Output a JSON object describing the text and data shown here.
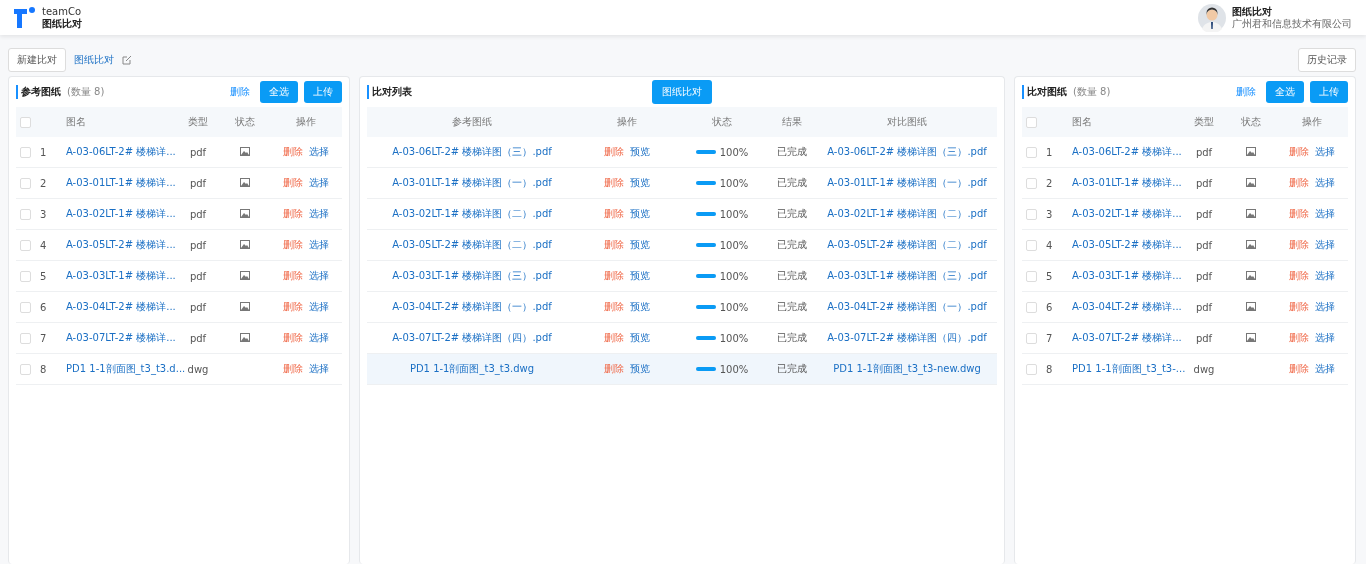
{
  "header": {
    "brand": "teamCo",
    "app": "图纸比对",
    "user_title": "图纸比对",
    "company": "广州君和信息技术有限公司"
  },
  "toolbar": {
    "new_button": "新建比对",
    "title": "图纸比对",
    "history_button": "历史记录"
  },
  "left_panel": {
    "header_checked": false,
    "title": "参考图纸",
    "count": "(数量 8)",
    "delete": "删除",
    "select_all": "全选",
    "upload": "上传",
    "columns": [
      "图名",
      "类型",
      "状态",
      "操作"
    ],
    "rows": [
      {
        "checked": false,
        "index": "1",
        "name": "A-03-06LT-2# 楼梯详...",
        "type": "pdf",
        "has_status": true,
        "delete": "删除",
        "choose": "选择"
      },
      {
        "checked": false,
        "index": "2",
        "name": "A-03-01LT-1# 楼梯详...",
        "type": "pdf",
        "has_status": true,
        "delete": "删除",
        "choose": "选择"
      },
      {
        "checked": false,
        "index": "3",
        "name": "A-03-02LT-1# 楼梯详...",
        "type": "pdf",
        "has_status": true,
        "delete": "删除",
        "choose": "选择"
      },
      {
        "checked": false,
        "index": "4",
        "name": "A-03-05LT-2# 楼梯详...",
        "type": "pdf",
        "has_status": true,
        "delete": "删除",
        "choose": "选择"
      },
      {
        "checked": false,
        "index": "5",
        "name": "A-03-03LT-1# 楼梯详...",
        "type": "pdf",
        "has_status": true,
        "delete": "删除",
        "choose": "选择"
      },
      {
        "checked": false,
        "index": "6",
        "name": "A-03-04LT-2# 楼梯详...",
        "type": "pdf",
        "has_status": true,
        "delete": "删除",
        "choose": "选择"
      },
      {
        "checked": false,
        "index": "7",
        "name": "A-03-07LT-2# 楼梯详...",
        "type": "pdf",
        "has_status": true,
        "delete": "删除",
        "choose": "选择"
      },
      {
        "checked": false,
        "index": "8",
        "name": "PD1 1-1剖面图_t3_t3.d...",
        "type": "dwg",
        "has_status": false,
        "delete": "删除",
        "choose": "选择"
      }
    ]
  },
  "compare_panel": {
    "title": "比对列表",
    "compare_button": "图纸比对",
    "columns": [
      "参考图纸",
      "操作",
      "状态",
      "结果",
      "对比图纸"
    ],
    "rows": [
      {
        "reference": "A-03-06LT-2# 楼梯详图（三）.pdf",
        "delete": "删除",
        "preview": "预览",
        "level": 1,
        "reading": "100%",
        "result": "已完成",
        "target": "A-03-06LT-2# 楼梯详图（三）.pdf",
        "highlighted": false
      },
      {
        "reference": "A-03-01LT-1# 楼梯详图（一）.pdf",
        "delete": "删除",
        "preview": "预览",
        "level": 1,
        "reading": "100%",
        "result": "已完成",
        "target": "A-03-01LT-1# 楼梯详图（一）.pdf",
        "highlighted": false
      },
      {
        "reference": "A-03-02LT-1# 楼梯详图（二）.pdf",
        "delete": "删除",
        "preview": "预览",
        "level": 1,
        "reading": "100%",
        "result": "已完成",
        "target": "A-03-02LT-1# 楼梯详图（二）.pdf",
        "highlighted": false
      },
      {
        "reference": "A-03-05LT-2# 楼梯详图（二）.pdf",
        "delete": "删除",
        "preview": "预览",
        "level": 1,
        "reading": "100%",
        "result": "已完成",
        "target": "A-03-05LT-2# 楼梯详图（二）.pdf",
        "highlighted": false
      },
      {
        "reference": "A-03-03LT-1# 楼梯详图（三）.pdf",
        "delete": "删除",
        "preview": "预览",
        "level": 1,
        "reading": "100%",
        "result": "已完成",
        "target": "A-03-03LT-1# 楼梯详图（三）.pdf",
        "highlighted": false
      },
      {
        "reference": "A-03-04LT-2# 楼梯详图（一）.pdf",
        "delete": "删除",
        "preview": "预览",
        "level": 1,
        "reading": "100%",
        "result": "已完成",
        "target": "A-03-04LT-2# 楼梯详图（一）.pdf",
        "highlighted": false
      },
      {
        "reference": "A-03-07LT-2# 楼梯详图（四）.pdf",
        "delete": "删除",
        "preview": "预览",
        "level": 1,
        "reading": "100%",
        "result": "已完成",
        "target": "A-03-07LT-2# 楼梯详图（四）.pdf",
        "highlighted": false
      },
      {
        "reference": "PD1 1-1剖面图_t3_t3.dwg",
        "delete": "删除",
        "preview": "预览",
        "level": 1,
        "reading": "100%",
        "result": "已完成",
        "target": "PD1 1-1剖面图_t3_t3-new.dwg",
        "highlighted": true
      }
    ]
  },
  "right_panel": {
    "header_checked": false,
    "title": "比对图纸",
    "count": "(数量 8)",
    "delete": "删除",
    "select_all": "全选",
    "upload": "上传",
    "columns": [
      "图名",
      "类型",
      "状态",
      "操作"
    ],
    "rows": [
      {
        "checked": false,
        "index": "1",
        "name": "A-03-06LT-2# 楼梯详...",
        "type": "pdf",
        "has_status": true,
        "delete": "删除",
        "choose": "选择"
      },
      {
        "checked": false,
        "index": "2",
        "name": "A-03-01LT-1# 楼梯详...",
        "type": "pdf",
        "has_status": true,
        "delete": "删除",
        "choose": "选择"
      },
      {
        "checked": false,
        "index": "3",
        "name": "A-03-02LT-1# 楼梯详...",
        "type": "pdf",
        "has_status": true,
        "delete": "删除",
        "choose": "选择"
      },
      {
        "checked": false,
        "index": "4",
        "name": "A-03-05LT-2# 楼梯详...",
        "type": "pdf",
        "has_status": true,
        "delete": "删除",
        "choose": "选择"
      },
      {
        "checked": false,
        "index": "5",
        "name": "A-03-03LT-1# 楼梯详...",
        "type": "pdf",
        "has_status": true,
        "delete": "删除",
        "choose": "选择"
      },
      {
        "checked": false,
        "index": "6",
        "name": "A-03-04LT-2# 楼梯详...",
        "type": "pdf",
        "has_status": true,
        "delete": "删除",
        "choose": "选择"
      },
      {
        "checked": false,
        "index": "7",
        "name": "A-03-07LT-2# 楼梯详...",
        "type": "pdf",
        "has_status": true,
        "delete": "删除",
        "choose": "选择"
      },
      {
        "checked": false,
        "index": "8",
        "name": "PD1 1-1剖面图_t3_t3-...",
        "type": "dwg",
        "has_status": false,
        "delete": "删除",
        "choose": "选择"
      }
    ]
  }
}
